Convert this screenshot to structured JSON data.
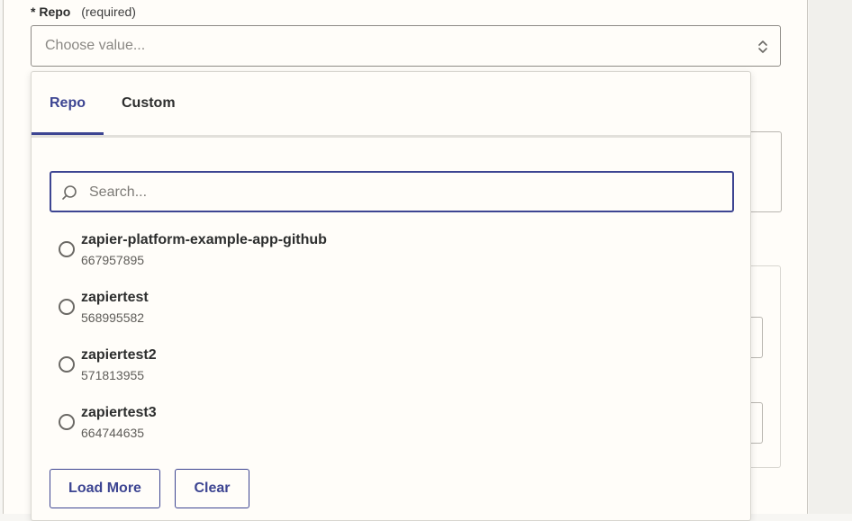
{
  "field": {
    "required_mark": "*",
    "label": "Repo",
    "hint": "(required)",
    "select_placeholder": "Choose value..."
  },
  "dropdown": {
    "tabs": [
      {
        "label": "Repo",
        "active": true
      },
      {
        "label": "Custom",
        "active": false
      }
    ],
    "search_placeholder": "Search...",
    "options": [
      {
        "title": "zapier-platform-example-app-github",
        "id": "667957895"
      },
      {
        "title": "zapiertest",
        "id": "568995582"
      },
      {
        "title": "zapiertest2",
        "id": "571813955"
      },
      {
        "title": "zapiertest3",
        "id": "664744635"
      }
    ],
    "buttons": {
      "load_more": "Load More",
      "clear": "Clear"
    }
  },
  "colors": {
    "accent": "#3d4592",
    "text": "#2d2e2e",
    "muted": "#8a8884"
  },
  "icons": [
    "chevron-up-down-icon",
    "search-icon",
    "radio-icon"
  ]
}
